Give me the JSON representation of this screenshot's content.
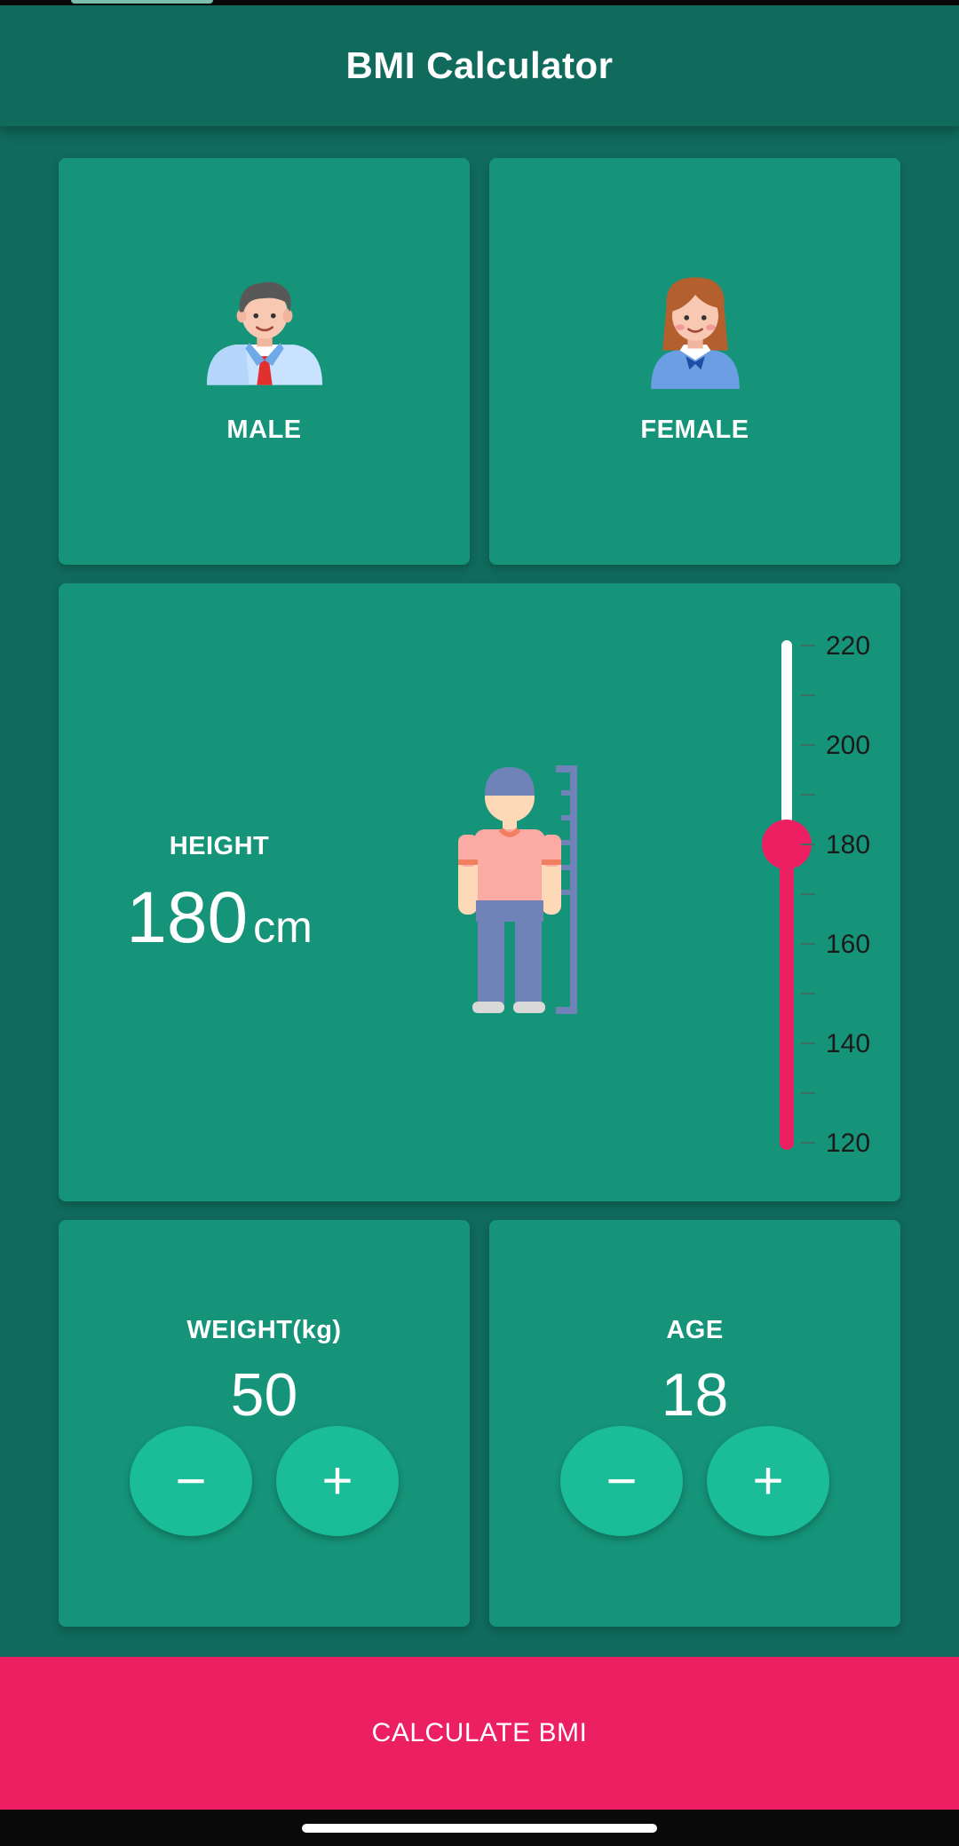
{
  "app": {
    "title": "BMI Calculator"
  },
  "gender": {
    "male": {
      "label": "MALE",
      "icon": "male-avatar-icon"
    },
    "female": {
      "label": "FEMALE",
      "icon": "female-avatar-icon"
    }
  },
  "height": {
    "label": "HEIGHT",
    "value": "180",
    "unit": "cm",
    "slider": {
      "min": 120,
      "max": 220,
      "current": 180,
      "ticks": [
        "220",
        "200",
        "180",
        "160",
        "140",
        "120"
      ]
    }
  },
  "weight": {
    "label": "WEIGHT(kg)",
    "value": "50",
    "minus": "−",
    "plus": "+"
  },
  "age": {
    "label": "AGE",
    "value": "18",
    "minus": "−",
    "plus": "+"
  },
  "calculate_button": {
    "label": "CALCULATE BMI"
  },
  "colors": {
    "background": "#106B5D",
    "card": "#159479",
    "button": "#1BBC98",
    "accent": "#EC1F63"
  }
}
